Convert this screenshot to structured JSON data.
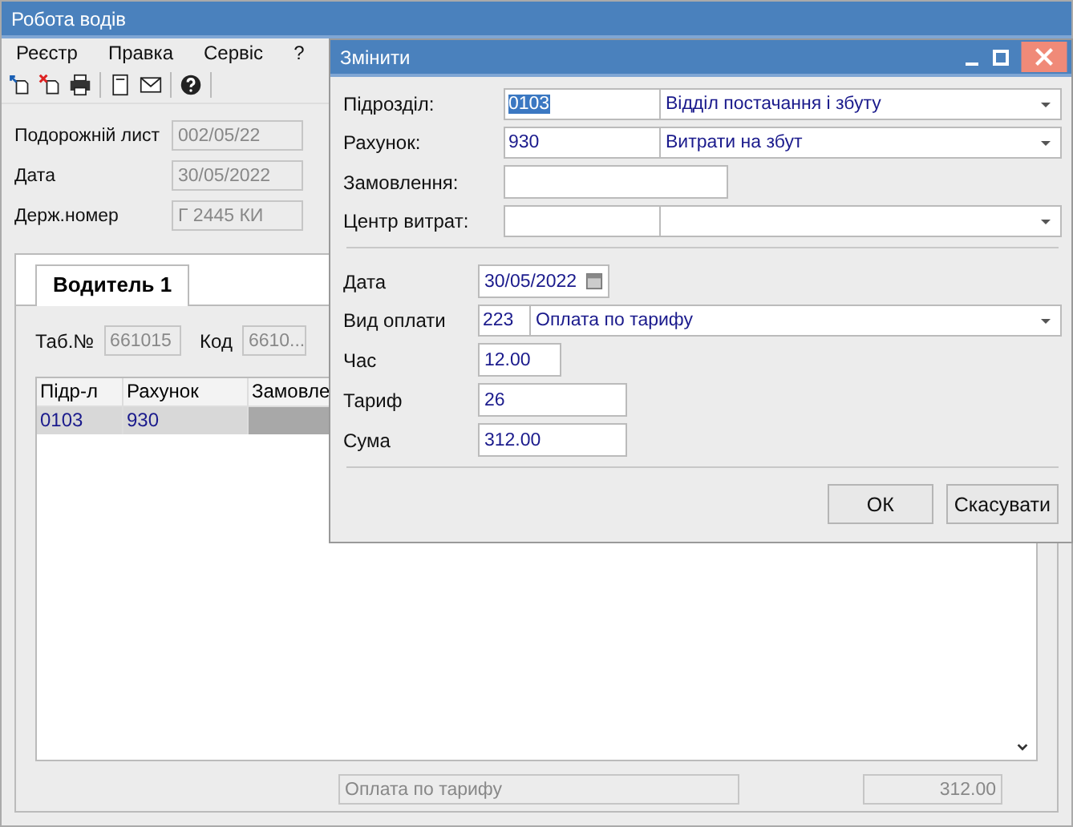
{
  "window": {
    "title": "Робота водів"
  },
  "menu": [
    "Реєстр",
    "Правка",
    "Сервіс",
    "?"
  ],
  "header_fields": [
    {
      "label": "Подорожній лист",
      "value": "002/05/22",
      "disabled": true
    },
    {
      "label": "Дата",
      "value": "30/05/2022",
      "disabled": true
    },
    {
      "label": "Держ.номер",
      "value": "Г 2445 КИ",
      "disabled": true
    }
  ],
  "tabs": [
    {
      "label": "Водитель 1",
      "selected": true
    }
  ],
  "driver_fields": [
    {
      "label": "Таб.№",
      "value": "661015",
      "disabled": true
    },
    {
      "label": "Код",
      "value": "6610...",
      "disabled": true
    }
  ],
  "table": {
    "columns": [
      "Підр-л",
      "Рахунок",
      "Замовле"
    ],
    "rows": [
      {
        "cells": [
          "0103",
          "930"
        ],
        "selected": true
      }
    ]
  },
  "footer_fields": [
    "Оплата по тарифу",
    "312.00"
  ],
  "dialog": {
    "title": "Змінити",
    "sections": [
      [
        {
          "kind": "combo",
          "label": "Підрозділ:",
          "code": "0103",
          "code_selected": true,
          "text": "Відділ постачання і збуту"
        },
        {
          "kind": "combo",
          "label": "Рахунок:",
          "code": "930",
          "text": "Витрати на збут"
        },
        {
          "kind": "input",
          "label": "Замовлення:"
        },
        {
          "kind": "combo",
          "label": "Центр витрат:"
        }
      ],
      [
        {
          "kind": "date",
          "label": "Дата",
          "value": "30/05/2022"
        },
        {
          "kind": "combo",
          "label": "Вид оплати",
          "code": "223",
          "text": "Оплата по тарифу"
        },
        {
          "kind": "input",
          "label": "Час",
          "value": "12.00"
        },
        {
          "kind": "input",
          "label": "Тариф",
          "value": "26"
        },
        {
          "kind": "input",
          "label": "Сума",
          "value": "312.00"
        }
      ]
    ],
    "buttons": [
      "ОК",
      "Скасувати"
    ]
  }
}
